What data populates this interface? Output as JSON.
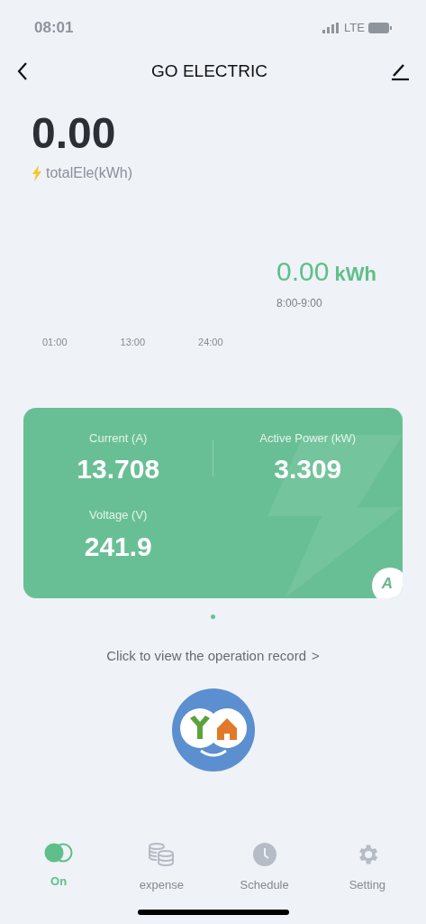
{
  "status_bar": {
    "time": "08:01",
    "network": "LTE"
  },
  "header": {
    "title": "GO ELECTRIC"
  },
  "total": {
    "value": "0.00",
    "label": "totalEle(kWh)"
  },
  "usage": {
    "value": "0.00",
    "unit": "kWh",
    "period": "8:00-9:00",
    "axis_labels": [
      "01:00",
      "13:00",
      "24:00"
    ]
  },
  "metrics_card": {
    "metrics": [
      {
        "label": "Current (A)",
        "value": "13.708"
      },
      {
        "label": "Active Power (kW)",
        "value": "3.309"
      },
      {
        "label": "Voltage (V)",
        "value": "241.9"
      }
    ],
    "badge": "A"
  },
  "pager": [
    {
      "selected": true
    }
  ],
  "record_link": {
    "text": "Click to view the operation record",
    "arrow": ">"
  },
  "tabs": [
    {
      "label": "On",
      "kind": "power",
      "selected": true
    },
    {
      "label": "expense",
      "kind": "coins",
      "selected": false
    },
    {
      "label": "Schedule",
      "kind": "clock",
      "selected": false
    },
    {
      "label": "Setting",
      "kind": "gear",
      "selected": false
    }
  ]
}
